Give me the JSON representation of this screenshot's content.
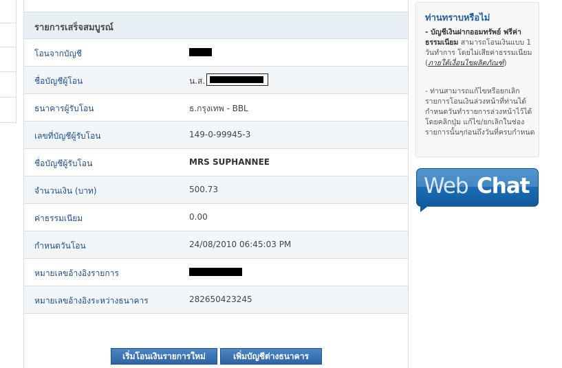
{
  "panel": {
    "title": "รายการเสร็จสมบูรณ์"
  },
  "rows": [
    {
      "label": "โอนจากบัญชี",
      "value": ""
    },
    {
      "label": "ชื่อบัญชีผู้โอน",
      "value": "น.ส."
    },
    {
      "label": "ธนาคารผู้รับโอน",
      "value": "ธ.กรุงเทพ - BBL"
    },
    {
      "label": "เลขที่บัญชีผู้รับโอน",
      "value": "149-0-99945-3"
    },
    {
      "label": "ชื่อบัญชีผู้รับโอน",
      "value": "MRS SUPHANNEE"
    },
    {
      "label": "จำนวนเงิน (บาท)",
      "value": "500.73"
    },
    {
      "label": "ค่าธรรมเนียม",
      "value": "0.00"
    },
    {
      "label": "กำหนดวันโอน",
      "value": "24/08/2010 06:45:03 PM"
    },
    {
      "label": "หมายเลขอ้างอิงรายการ",
      "value": ""
    },
    {
      "label": "หมายเลขอ้างอิงระหว่างธนาคาร",
      "value": "282650423245"
    }
  ],
  "buttons": {
    "new_transfer": "เริ่มโอนเงินรายการใหม่",
    "add_account": "เพิ่มบัญชีต่างธนาคาร"
  },
  "info": {
    "title": "ท่านทราบหรือไม่",
    "p1_bold": "- บัญชีเงินฝากออมทรัพย์ ฟรีค่าธรรมเนียม",
    "p1_text": " สามารถโอนเงินแบบ 1 วันทำการ โดยไม่เสียค่าธรรมเนียม (",
    "p1_link": "ภายใต้เงื่อนไขผลิตภัณฑ์",
    "p1_end": ")",
    "p2": "- ท่านสามารถแก้ไขหรือยกเลิก รายการโอนเงินล่วงหน้าที่ท่านได้กำหนดวันทำรายการล่วงหน้าไว้ได้ โดยคลิกปุ่ม แก้ไข/ยกเลิกในช่องรายการนั้นๆก่อนถึงวันที่ครบกำหนด"
  },
  "webchat": {
    "web": "Web",
    "chat": "Chat"
  },
  "colors": {
    "label": "#1a4f8b",
    "header_bg": "#e8eff5",
    "button": "#2f64a3",
    "info_title": "#1f5d9b"
  }
}
